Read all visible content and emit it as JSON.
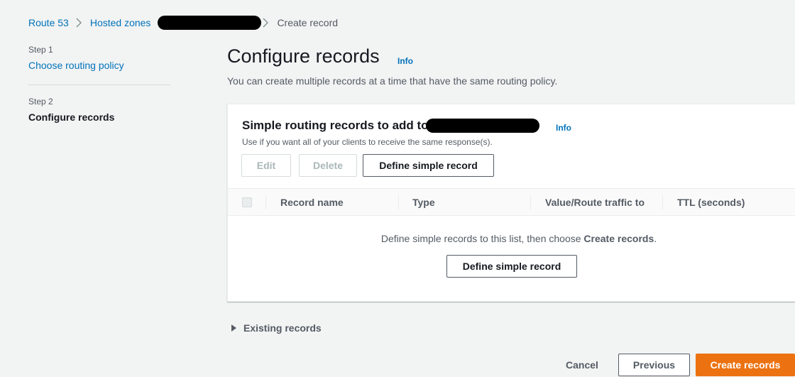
{
  "breadcrumb": {
    "items": [
      "Route 53",
      "Hosted zones"
    ],
    "current": "Create record"
  },
  "steps": [
    {
      "label": "Step 1",
      "title": "Choose routing policy"
    },
    {
      "label": "Step 2",
      "title": "Configure records"
    }
  ],
  "header": {
    "title": "Configure records",
    "info": "Info",
    "description": "You can create multiple records at a time that have the same routing policy."
  },
  "panel": {
    "title": "Simple routing records to add to",
    "info": "Info",
    "description": "Use if you want all of your clients to receive the same response(s).",
    "buttons": {
      "edit": "Edit",
      "delete": "Delete",
      "define": "Define simple record"
    },
    "columns": [
      "Record name",
      "Type",
      "Value/Route traffic to",
      "TTL (seconds)"
    ],
    "empty": {
      "prefix": "Define simple records to this list, then choose ",
      "emphasis": "Create records",
      "suffix": ".",
      "button": "Define simple record"
    }
  },
  "existing_records": {
    "label": "Existing records"
  },
  "footer": {
    "cancel": "Cancel",
    "previous": "Previous",
    "create": "Create records"
  },
  "colors": {
    "link": "#0073bb",
    "primary": "#ec7211",
    "background": "#f2f3f3"
  }
}
